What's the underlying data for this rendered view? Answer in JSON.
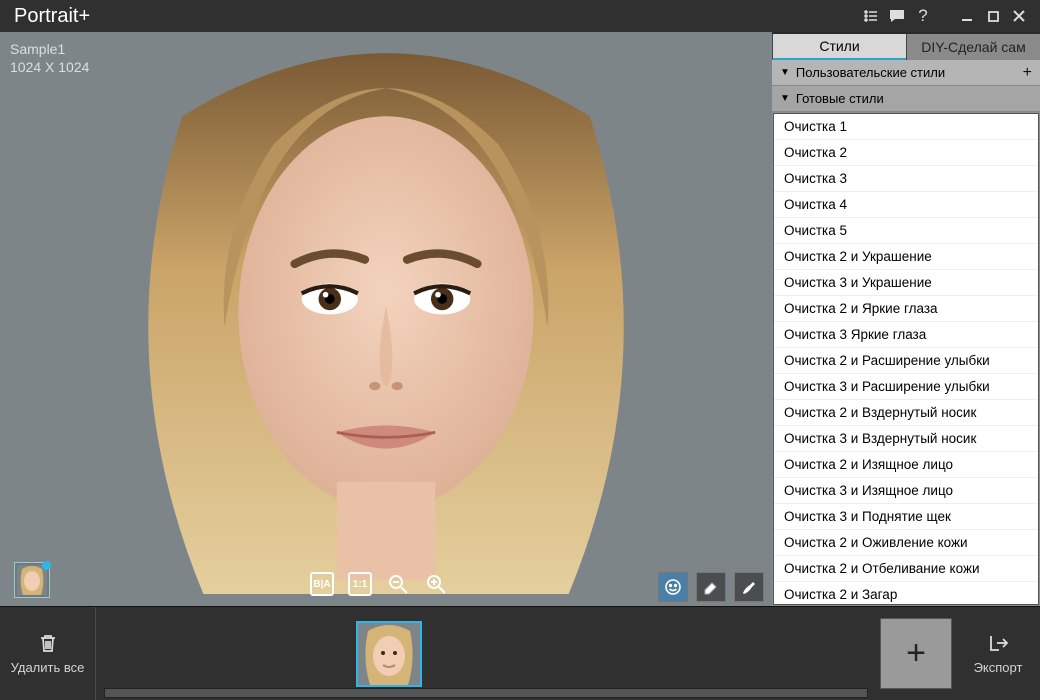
{
  "app": {
    "title": "Portrait+"
  },
  "sample": {
    "name": "Sample1",
    "dims": "1024 X 1024"
  },
  "tabs": {
    "styles": "Стили",
    "diy": "DIY-Сделай сам"
  },
  "sections": {
    "user": "Пользовательские стили",
    "ready": "Готовые стили"
  },
  "presets": [
    "Очистка 1",
    "Очистка 2",
    "Очистка 3",
    "Очистка 4",
    "Очистка 5",
    "Очистка 2 и Украшение",
    "Очистка 3 и Украшение",
    "Очистка 2 и Яркие глаза",
    "Очистка 3 Яркие глаза",
    "Очистка 2 и Расширение улыбки",
    "Очистка 3 и Расширение улыбки",
    "Очистка 2 и Вздернутый носик",
    "Очистка 3 и Вздернутый носик",
    "Очистка 2 и Изящное лицо",
    "Очистка 3 и Изящное лицо",
    "Очистка 3 и Поднятие щек",
    "Очистка 2 и Оживление кожи",
    "Очистка 2 и Отбеливание кожи",
    "Очистка 2 и Загар"
  ],
  "tools": {
    "ba": "B|A",
    "one": "1:1"
  },
  "footer": {
    "delete_all": "Удалить все",
    "export": "Экспорт"
  }
}
